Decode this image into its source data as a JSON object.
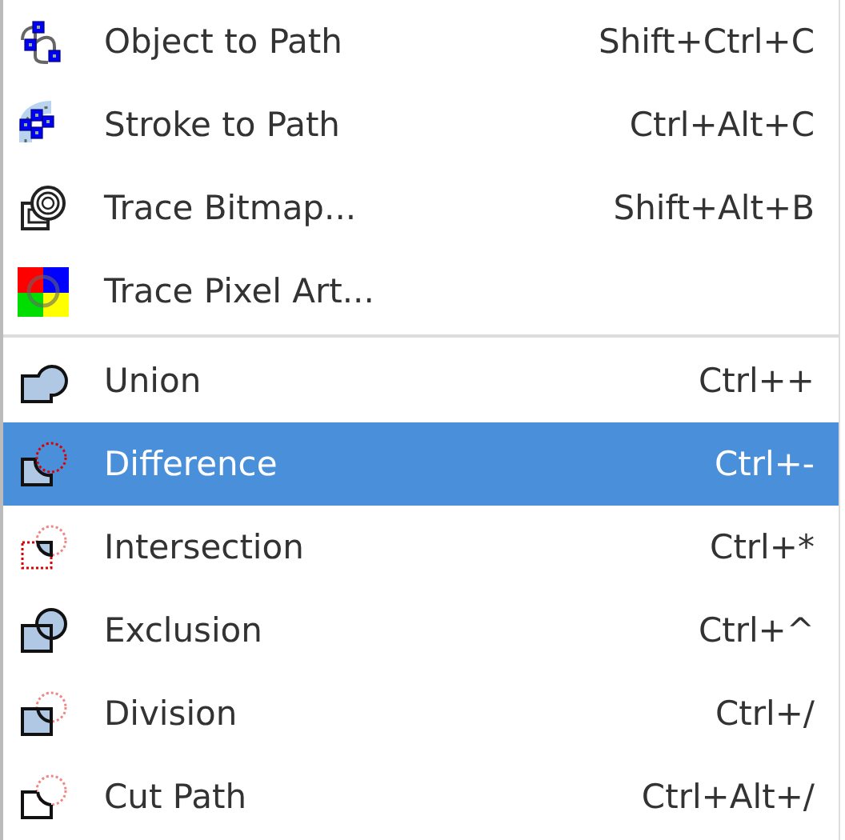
{
  "menu": {
    "groups": [
      {
        "items": [
          {
            "label": "Object to Path",
            "shortcut": "Shift+Ctrl+C",
            "selected": false
          },
          {
            "label": "Stroke to Path",
            "shortcut": "Ctrl+Alt+C",
            "selected": false
          },
          {
            "label": "Trace Bitmap...",
            "shortcut": "Shift+Alt+B",
            "selected": false
          },
          {
            "label": "Trace Pixel Art...",
            "selected": false
          }
        ]
      },
      {
        "items": [
          {
            "label": "Union",
            "shortcut": "Ctrl++",
            "selected": false
          },
          {
            "label": "Difference",
            "shortcut": "Ctrl+-",
            "selected": true
          },
          {
            "label": "Intersection",
            "shortcut": "Ctrl+*",
            "selected": false
          },
          {
            "label": "Exclusion",
            "shortcut": "Ctrl+^",
            "selected": false
          },
          {
            "label": "Division",
            "shortcut": "Ctrl+/",
            "selected": false
          },
          {
            "label": "Cut Path",
            "shortcut": "Ctrl+Alt+/",
            "selected": false
          }
        ]
      }
    ]
  }
}
